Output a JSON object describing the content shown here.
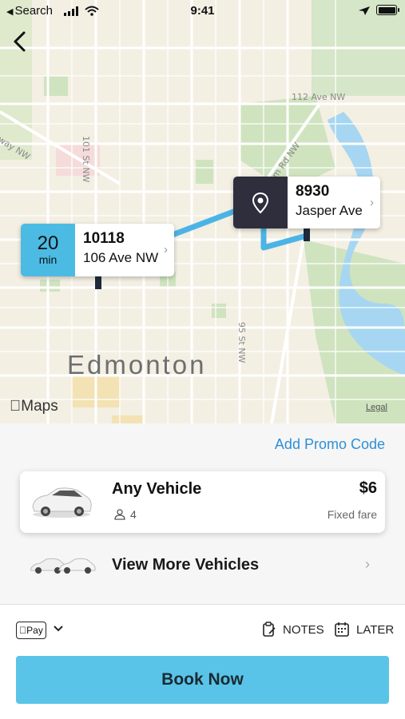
{
  "status_bar": {
    "back_app": "Search",
    "time": "9:41"
  },
  "map": {
    "city_label": "Edmonton",
    "streets": [
      "112 Ave NW",
      "101 St NW",
      "way NW",
      "m Rd NW",
      "95 St NW"
    ],
    "attribution": "Maps",
    "legal": "Legal",
    "pickup": {
      "eta_value": "20",
      "eta_unit": "min",
      "line1": "10118",
      "line2": "106 Ave NW",
      "badge_color": "#4bbbe3"
    },
    "dropoff": {
      "line1": "8930",
      "line2": "Jasper Ave",
      "badge_color": "#2e2e3d"
    },
    "route_color": "#4bb4e6"
  },
  "promo": {
    "label": "Add Promo Code"
  },
  "vehicle": {
    "name": "Any Vehicle",
    "capacity": "4",
    "price": "$6",
    "fare_type": "Fixed fare"
  },
  "more_vehicles": {
    "label": "View More Vehicles"
  },
  "footer": {
    "payment": "Pay",
    "notes_label": "NOTES",
    "later_label": "LATER",
    "book_label": "Book Now",
    "book_color": "#59c4e8"
  }
}
